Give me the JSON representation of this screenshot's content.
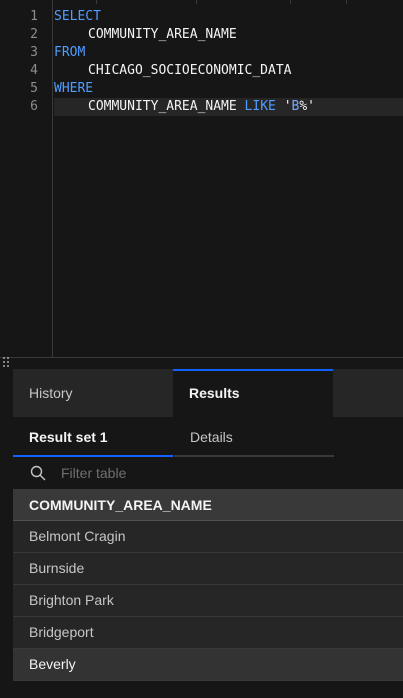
{
  "editor": {
    "lines": [
      {
        "num": "1",
        "kw": "SELECT",
        "text": ""
      },
      {
        "num": "2",
        "kw": "",
        "text": "COMMUNITY_AREA_NAME"
      },
      {
        "num": "3",
        "kw": "FROM",
        "text": ""
      },
      {
        "num": "4",
        "kw": "",
        "text": "CHICAGO_SOCIOECONOMIC_DATA"
      },
      {
        "num": "5",
        "kw": "WHERE",
        "text": ""
      },
      {
        "num": "6",
        "kw": "",
        "text": "COMMUNITY_AREA_NAME",
        "op": "LIKE",
        "str_open": "'",
        "str_b": "B",
        "str_rest": "%'"
      }
    ]
  },
  "panel": {
    "tabs": {
      "history": "History",
      "results": "Results"
    },
    "subtabs": {
      "result_set": "Result set 1",
      "details": "Details"
    },
    "filter_placeholder": "Filter table",
    "table": {
      "header": "COMMUNITY_AREA_NAME",
      "rows": [
        "Belmont Cragin",
        "Burnside",
        "Brighton Park",
        "Bridgeport",
        "Beverly"
      ]
    }
  },
  "colors": {
    "accent": "#0f62fe",
    "keyword": "#4f9dff"
  }
}
